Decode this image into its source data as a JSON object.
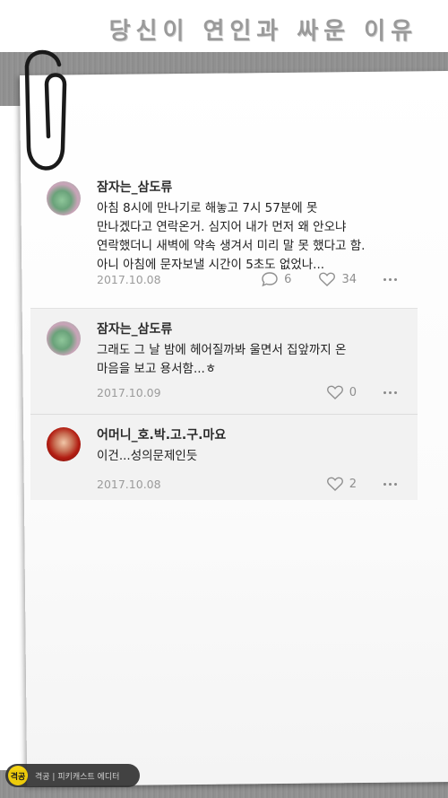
{
  "title": "당신이 연인과 싸운 이유",
  "comments": [
    {
      "author": "잠자는_삼도류",
      "text": "아침 8시에 만나기로 해놓고 7시 57분에 못\n만나겠다고 연락온거. 심지어 내가 먼저 왜 안오냐\n연락했더니 새벽에 약속 생겨서 미리 말 못 했다고 함.\n아니 아침에 문자보낼 시간이 5초도 없었나...",
      "date": "2017.10.08",
      "replies": "6",
      "likes": "34"
    },
    {
      "author": "잠자는_삼도류",
      "text": "그래도 그 날 밤에 헤어질까봐 울면서 집앞까지 온\n마음을 보고 용서함...ㅎ",
      "date": "2017.10.09",
      "likes": "0"
    },
    {
      "author": "어머니_호.박.고.구.마요",
      "text": "이건...성의문제인듯",
      "date": "2017.10.08",
      "likes": "2"
    }
  ],
  "watermark": {
    "logo": "격공",
    "text": "격공 | 피키캐스트 에디터"
  },
  "icons": {
    "reply": "speech-bubble-icon",
    "like": "heart-icon",
    "more": "more-dots-icon",
    "clip": "paperclip-icon"
  }
}
